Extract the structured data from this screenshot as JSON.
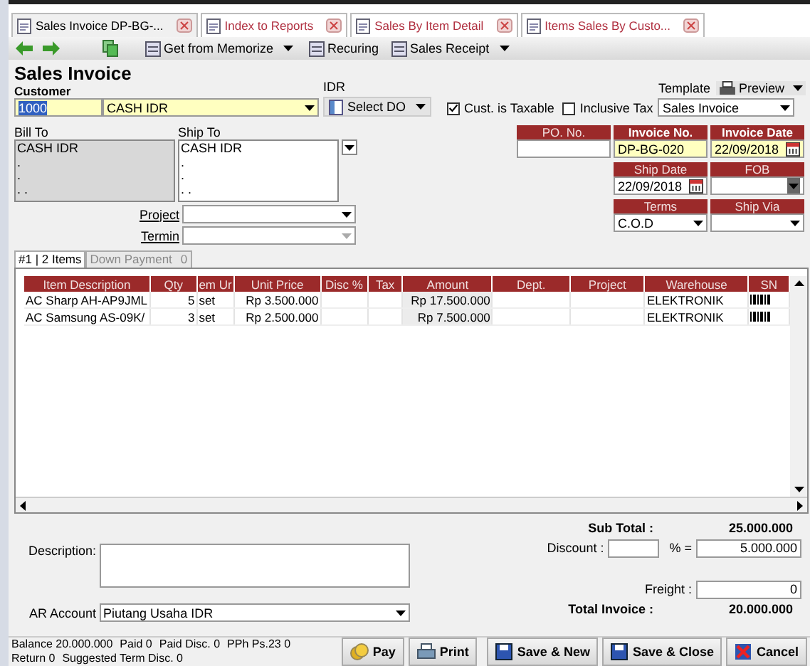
{
  "tabs": [
    {
      "label": "Sales Invoice DP-BG-...",
      "selected": true
    },
    {
      "label": "Index to Reports",
      "selected": false
    },
    {
      "label": "Sales By Item Detail",
      "selected": false
    },
    {
      "label": "Items Sales By Custo...",
      "selected": false
    }
  ],
  "toolbar": [
    {
      "label": "Get from Memorize",
      "dropdown": true
    },
    {
      "label": "Recuring",
      "dropdown": false
    },
    {
      "label": "Sales Receipt",
      "dropdown": true
    }
  ],
  "title": "Sales Invoice",
  "customer": {
    "label": "Customer",
    "code": "1000",
    "name": "CASH IDR",
    "currency": "IDR"
  },
  "select_do": "Select DO",
  "checks": [
    {
      "label": "Cust. is Taxable",
      "checked": true
    },
    {
      "label": "Inclusive Tax",
      "checked": false
    }
  ],
  "template": {
    "label": "Template",
    "value": "Sales Invoice",
    "preview": "Preview"
  },
  "bill_to": {
    "label": "Bill To",
    "lines": [
      "CASH IDR",
      ".",
      ".",
      ". ."
    ]
  },
  "ship_to": {
    "label": "Ship To",
    "lines": [
      "CASH IDR",
      ".",
      ".",
      ". ."
    ]
  },
  "header_fields": [
    {
      "label": "PO. No.",
      "kind": "text",
      "highlight": false
    },
    {
      "label": "Invoice No.",
      "value": "DP-BG-020",
      "kind": "text",
      "highlight": true
    },
    {
      "label": "Invoice Date",
      "value": "22/09/2018",
      "kind": "date",
      "highlight": true
    },
    {
      "label": "Ship Date",
      "value": "22/09/2018",
      "kind": "date",
      "highlight": false
    },
    {
      "label": "FOB",
      "kind": "dark-select",
      "highlight": false
    },
    {
      "label": "Terms",
      "value": "C.O.D",
      "kind": "select",
      "highlight": false
    },
    {
      "label": "Ship Via",
      "kind": "select",
      "highlight": false
    }
  ],
  "project": {
    "label": "Project",
    "disabled": false
  },
  "termin": {
    "label": "Termin",
    "disabled": true
  },
  "subtabs": [
    {
      "label": "#1 | 2 Items",
      "selected": true
    },
    {
      "label": "Down Payment",
      "count": "0",
      "selected": false
    }
  ],
  "table": {
    "columns": [
      "Item Description",
      "Qty",
      "em Ur",
      "Unit Price",
      "Disc %",
      "Tax",
      "Amount",
      "Dept.",
      "Project",
      "Warehouse",
      "SN"
    ],
    "rows": [
      {
        "item": "AC Sharp AH-AP9JML",
        "qty": "5",
        "unit": "set",
        "price": "Rp 3.500.000",
        "amount": "Rp 17.500.000",
        "warehouse": "ELEKTRONIK"
      },
      {
        "item": "AC Samsung AS-09K/",
        "qty": "3",
        "unit": "set",
        "price": "Rp 2.500.000",
        "amount": "Rp 7.500.000",
        "warehouse": "ELEKTRONIK"
      }
    ]
  },
  "description_label": "Description:",
  "ar_account": {
    "label": "AR Account",
    "value": "Piutang Usaha IDR"
  },
  "totals": {
    "subtotal_label": "Sub Total :",
    "subtotal": "25.000.000",
    "discount_label": "Discount :",
    "percent_label": "% =",
    "discount": "5.000.000",
    "freight_label": "Freight :",
    "freight": "0",
    "total_label": "Total Invoice :",
    "total": "20.000.000"
  },
  "status": [
    [
      "Balance 20.000.000",
      "Paid 0",
      "Paid Disc. 0",
      "PPh Ps.23 0"
    ],
    [
      "Return 0",
      "Suggested Term Disc. 0"
    ]
  ],
  "buttons": [
    {
      "label": "Pay",
      "kind": "pay"
    },
    {
      "label": "Print",
      "kind": "print"
    },
    {
      "label": "Save & New",
      "kind": "save"
    },
    {
      "label": "Save & Close",
      "kind": "save"
    },
    {
      "label": "Cancel",
      "kind": "cancel"
    }
  ]
}
